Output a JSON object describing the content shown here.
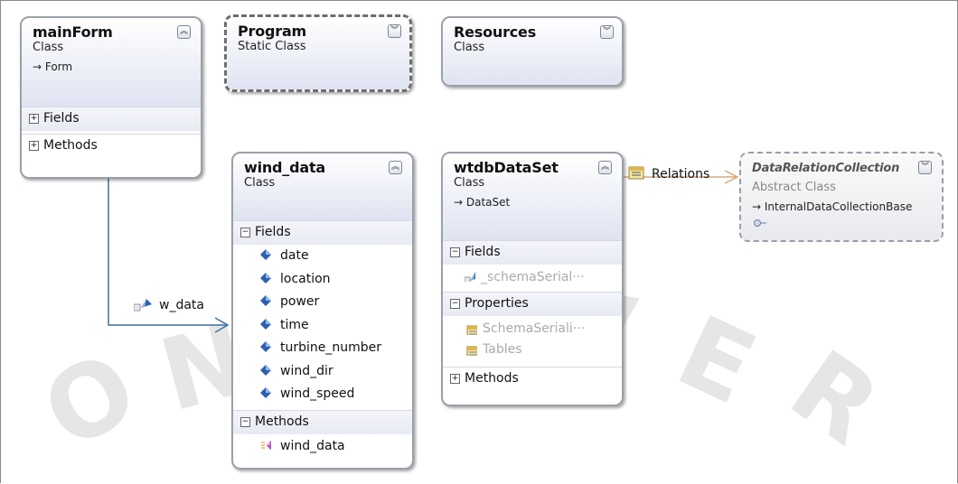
{
  "classes": {
    "mainForm": {
      "name": "mainForm",
      "kind": "Class",
      "base": "→ Form",
      "sections": [
        {
          "label": "Fields",
          "state": "collapsed"
        },
        {
          "label": "Methods",
          "state": "collapsed"
        }
      ]
    },
    "program": {
      "name": "Program",
      "kind": "Static Class"
    },
    "resources": {
      "name": "Resources",
      "kind": "Class"
    },
    "windData": {
      "name": "wind_data",
      "kind": "Class",
      "fields_label": "Fields",
      "fields": [
        "date",
        "location",
        "power",
        "time",
        "turbine_number",
        "wind_dir",
        "wind_speed"
      ],
      "methods_label": "Methods",
      "methods": [
        "wind_data"
      ]
    },
    "wtdbDataSet": {
      "name": "wtdbDataSet",
      "kind": "Class",
      "base": "→ DataSet",
      "fields_label": "Fields",
      "fields": [
        "_schemaSerial···"
      ],
      "properties_label": "Properties",
      "properties": [
        "SchemaSeriali···",
        "Tables"
      ],
      "methods_label": "Methods"
    },
    "dataRelationCollection": {
      "name": "DataRelationCollection",
      "kind": "Abstract Class",
      "base": "→ InternalDataCollectionBase"
    }
  },
  "associations": {
    "w_data": "w_data",
    "relations": "Relations"
  },
  "icons": {
    "expand": "chevron-double-down-icon",
    "collapse": "chevron-double-up-icon",
    "field": "field-icon",
    "property": "property-icon",
    "method": "method-icon"
  },
  "colors": {
    "assoc_line": "#3f6fa6",
    "relations_line": "#d9a77e",
    "field_icon": "#2d5fae",
    "method_icon": "#b24fb0"
  }
}
